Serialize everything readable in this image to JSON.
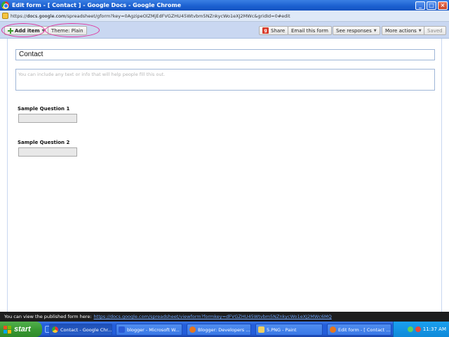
{
  "window": {
    "title": "Edit form - [ Contact ] - Google Docs - Google Chrome",
    "buttons": {
      "minimize": "_",
      "maximize": "□",
      "close": "×"
    }
  },
  "address": {
    "url_prefix": "https://",
    "url_host": "docs.google.com",
    "url_path": "/spreadsheet/gform?key=0AgzipeOlZMjEdFVGZHU45Wtvbm5NZnkycWo1eXJ2MWc&gridId=0#edit"
  },
  "toolbar": {
    "add_item": "Add item",
    "theme": "Theme: Plain",
    "share": "Share",
    "email_form": "Email this form",
    "see_responses": "See responses",
    "more_actions": "More actions",
    "saved": "Saved",
    "highlight_color": "#e0359e"
  },
  "form": {
    "title": "Contact",
    "description_placeholder": "You can include any text or info that will help people fill this out.",
    "questions": [
      {
        "label": "Sample Question 1"
      },
      {
        "label": "Sample Question 2"
      }
    ]
  },
  "notice": {
    "text": "You can view the published form here:",
    "link": "https://docs.google.com/spreadsheet/viewform?formkey=dFVGZHU45Wtvbm5NZnkycWo1eXJ2MWc6MQ"
  },
  "taskbar": {
    "start": "start",
    "tasks": [
      {
        "label": "Contact - Google Chr..."
      },
      {
        "label": "blogger - Microsoft W..."
      },
      {
        "label": "Blogger: Developers ..."
      },
      {
        "label": "5.PNG - Paint"
      },
      {
        "label": "Edit form - [ Contact ..."
      }
    ],
    "clock": "11:37 AM"
  }
}
